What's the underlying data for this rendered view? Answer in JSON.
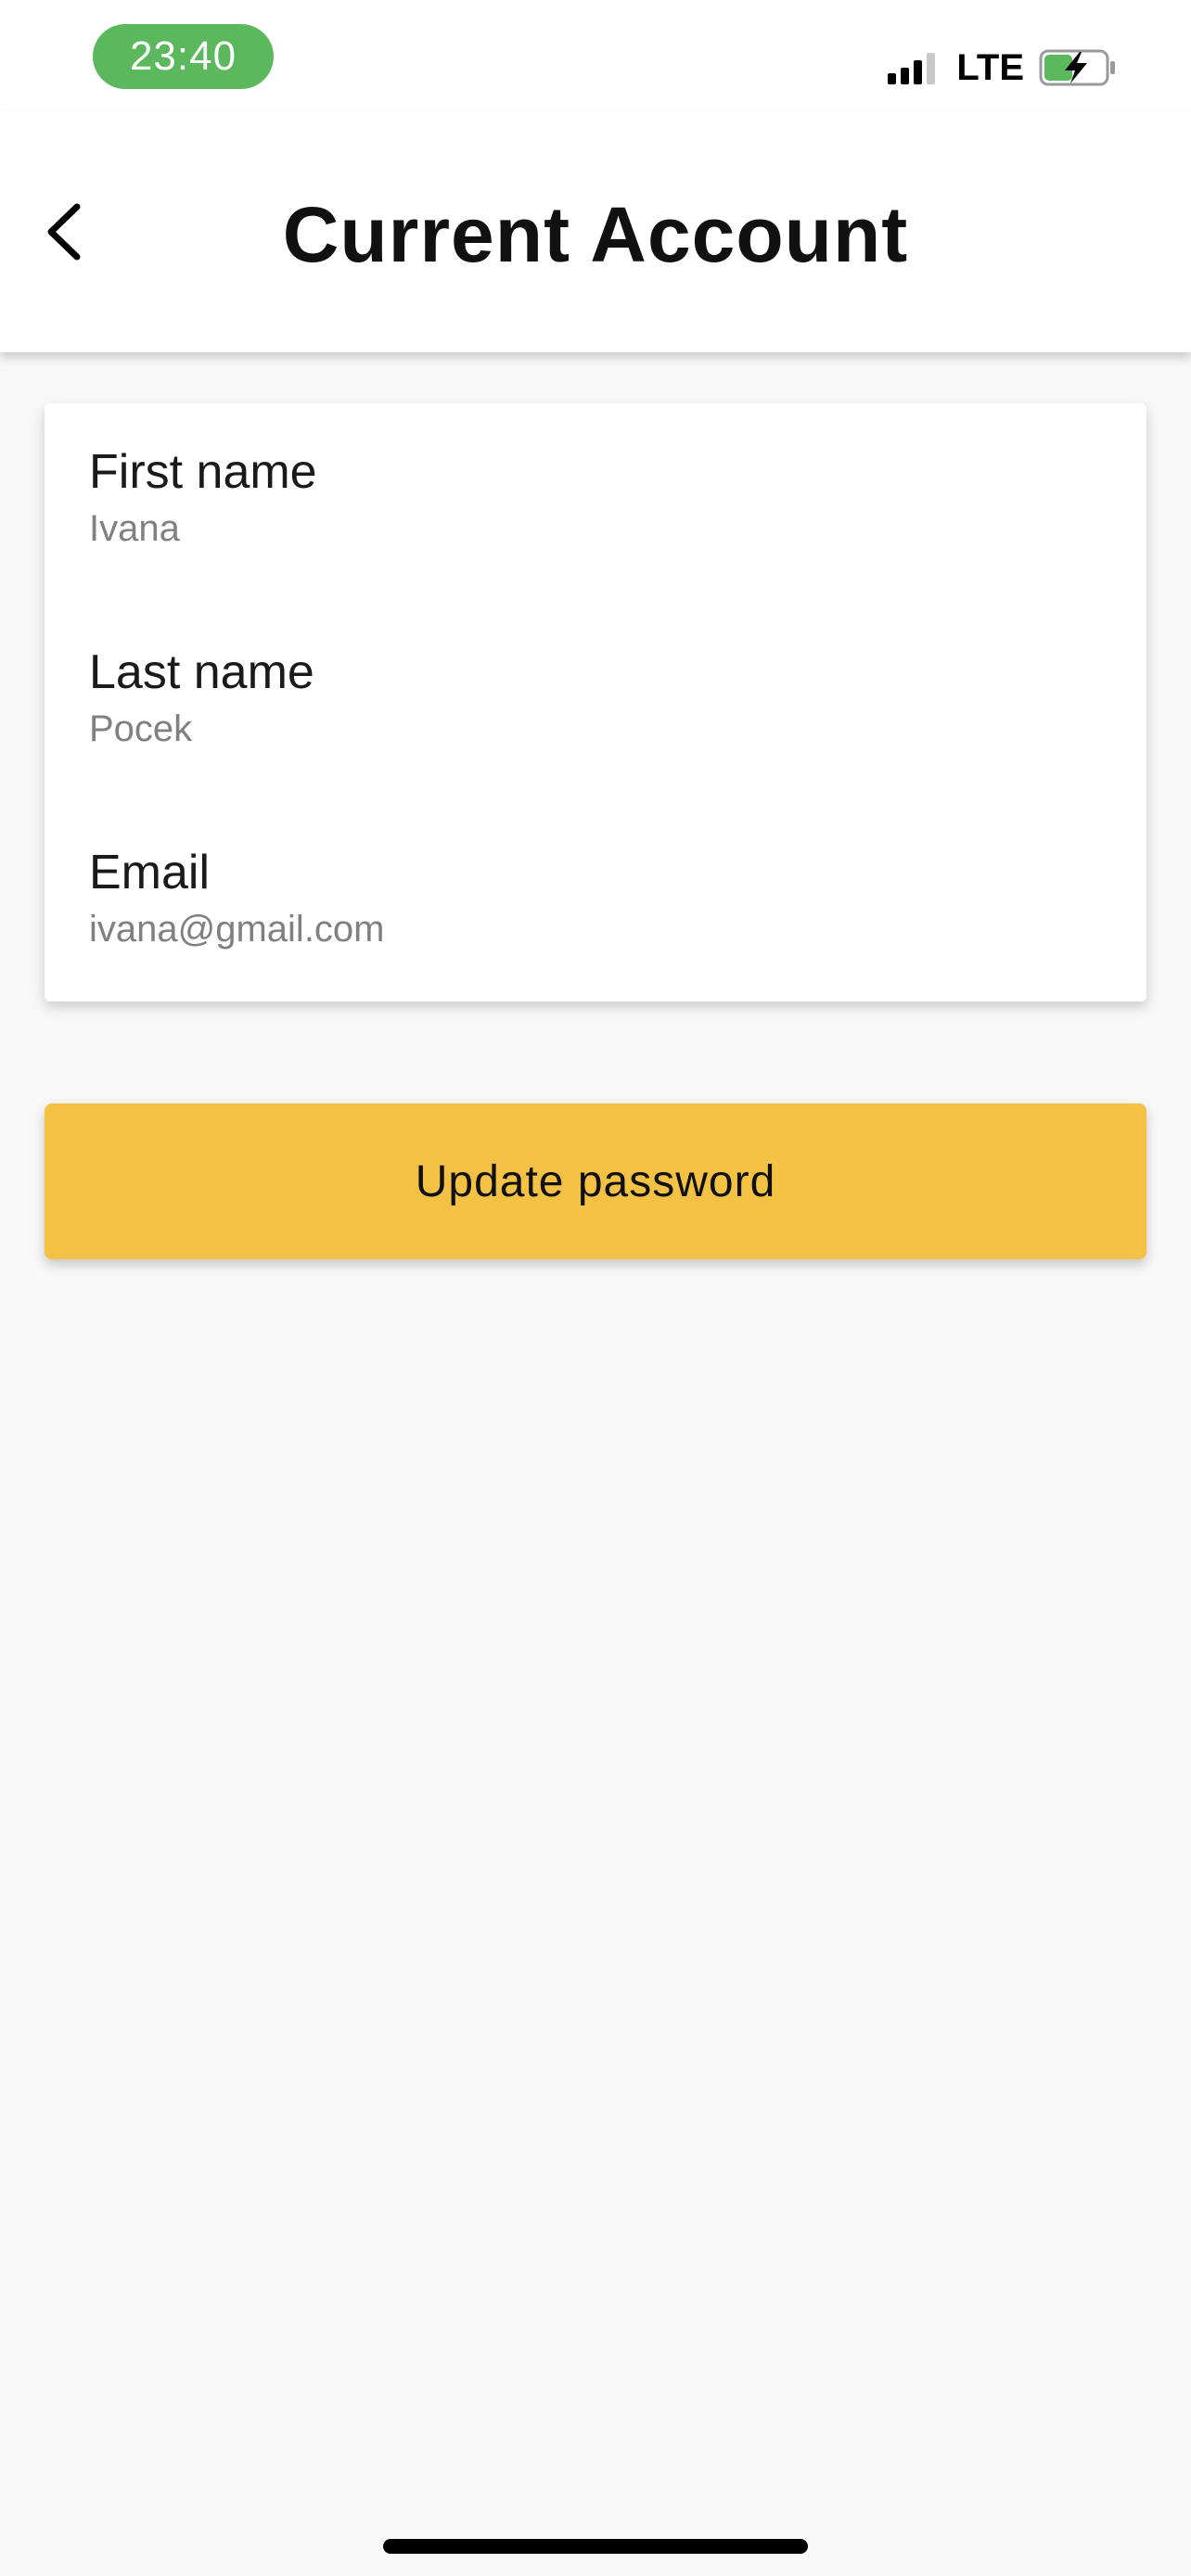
{
  "status_bar": {
    "time": "23:40",
    "network": "LTE",
    "time_pill_color": "#5cb85c",
    "battery_charging": true
  },
  "header": {
    "title": "Current Account",
    "back_icon": "chevron-left-icon"
  },
  "account": {
    "fields": [
      {
        "label": "First name",
        "value": "Ivana"
      },
      {
        "label": "Last name",
        "value": "Pocek"
      },
      {
        "label": "Email",
        "value": "ivana@gmail.com"
      }
    ]
  },
  "actions": {
    "update_password_label": "Update password",
    "button_color": "#f3c244"
  }
}
